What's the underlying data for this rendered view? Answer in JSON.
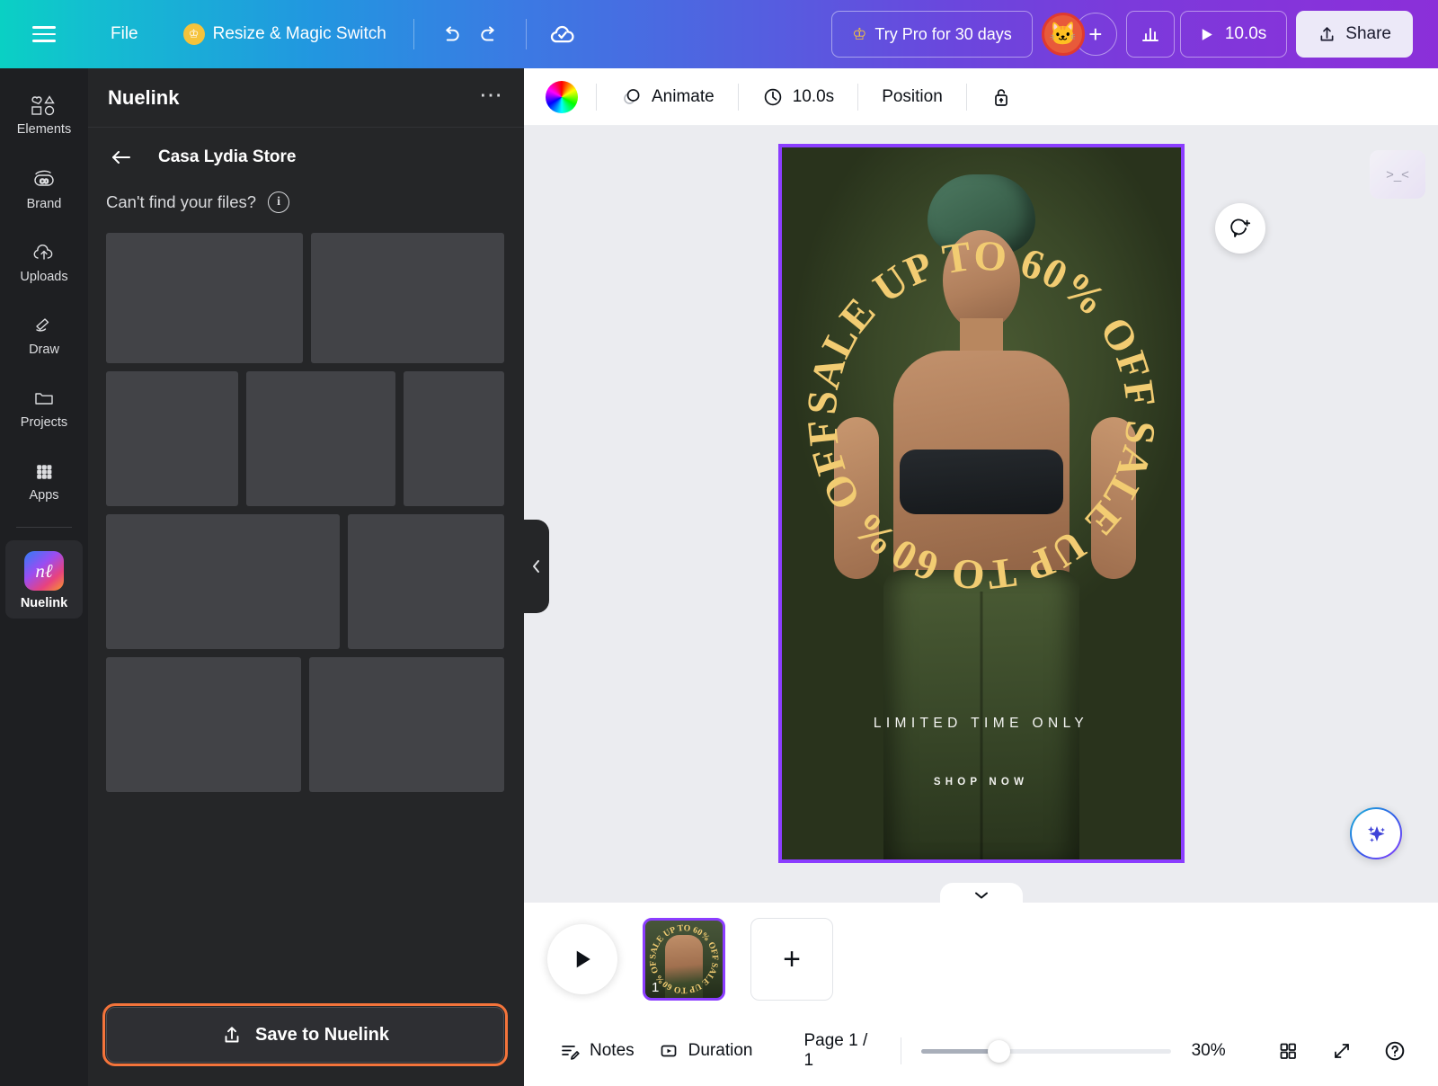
{
  "topbar": {
    "menu_icon": "hamburger-icon",
    "file_label": "File",
    "resize_label": "Resize & Magic Switch",
    "crown_icon": "crown-icon",
    "undo_icon": "undo-icon",
    "redo_icon": "redo-icon",
    "cloud_saved_icon": "cloud-check-icon",
    "try_pro_label": "Try Pro for 30 days",
    "avatar_icon": "cat-avatar",
    "add_member_icon": "plus-icon",
    "insights_icon": "bar-chart-icon",
    "play_icon": "play-icon",
    "duration_label": "10.0s",
    "share_icon": "share-upload-icon",
    "share_label": "Share"
  },
  "rail": {
    "items": [
      {
        "label": "Elements",
        "icon": "shapes-icon",
        "active": false
      },
      {
        "label": "Brand",
        "icon": "brand-icon",
        "active": false
      },
      {
        "label": "Uploads",
        "icon": "cloud-upload-icon",
        "active": false
      },
      {
        "label": "Draw",
        "icon": "pen-icon",
        "active": false
      },
      {
        "label": "Projects",
        "icon": "folder-icon",
        "active": false
      },
      {
        "label": "Apps",
        "icon": "grid-dots-icon",
        "active": false
      },
      {
        "label": "Nuelink",
        "icon": "nuelink-logo",
        "active": true
      }
    ]
  },
  "panel": {
    "title": "Nuelink",
    "more_icon": "more-options-icon",
    "back_icon": "back-arrow-icon",
    "breadcrumb": "Casa Lydia Store",
    "help_text": "Can't find your files?",
    "info_icon": "info-icon",
    "save_label": "Save to Nuelink",
    "save_icon": "upload-icon",
    "collapse_icon": "chevron-left-icon",
    "placeholder_rows": [
      [
        225,
        220
      ],
      [
        150,
        170,
        115
      ],
      [
        262,
        175
      ],
      [
        217,
        218
      ]
    ],
    "placeholder_heights": [
      145,
      150,
      150,
      150
    ]
  },
  "canvas_toolbar": {
    "color_icon": "color-wheel-icon",
    "animate_icon": "animate-icon",
    "animate_label": "Animate",
    "timer_icon": "clock-icon",
    "duration_label": "10.0s",
    "position_label": "Position",
    "lock_icon": "lock-icon"
  },
  "design": {
    "ring_text": "SALE UP TO 60% OFF ",
    "ring_text_repeat": "SALE UP TO 60% OFF SALE UP TO 60% OFF ",
    "headline_1": "LIMITED TIME ONLY",
    "headline_2": "SHOP NOW",
    "ring_color": "#f2cc72",
    "selection_color": "#8b3dff",
    "background_color": "#2e3a24"
  },
  "overlays": {
    "comment_icon": "add-comment-icon",
    "magic_icon": "magic-studio-sparkle-icon",
    "ghost_chip": ">_<",
    "expand_icon": "chevron-down-icon"
  },
  "pages": {
    "play_icon": "play-icon",
    "thumb_number": "1",
    "add_page_icon": "plus-icon"
  },
  "status": {
    "notes_icon": "notes-icon",
    "notes_label": "Notes",
    "duration_icon": "duration-icon",
    "duration_label": "Duration",
    "page_label": "Page 1 / 1",
    "zoom_value": "30%",
    "grid_view_icon": "grid-view-icon",
    "fullscreen_icon": "expand-icon",
    "help_icon": "help-circle-icon"
  }
}
